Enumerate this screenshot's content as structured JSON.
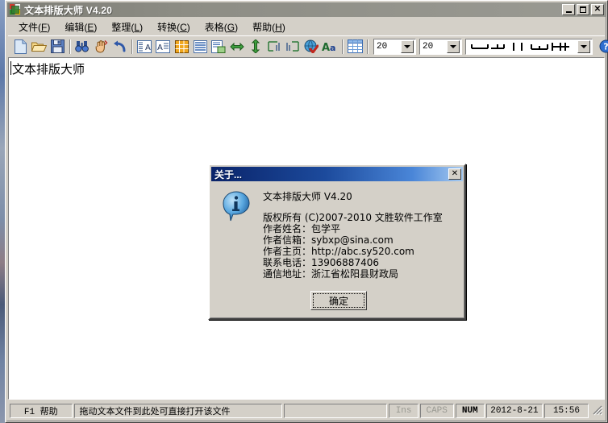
{
  "window": {
    "title": "文本排版大师  V4.20",
    "icon": "app-blocks-icon",
    "buttons": {
      "minimize": "_",
      "maximize": "□",
      "close": "✕"
    }
  },
  "menu": {
    "items": [
      {
        "label": "文件",
        "accel": "F"
      },
      {
        "label": "编辑",
        "accel": "E"
      },
      {
        "label": "整理",
        "accel": "L"
      },
      {
        "label": "转换",
        "accel": "C"
      },
      {
        "label": "表格",
        "accel": "G"
      },
      {
        "label": "帮助",
        "accel": "H"
      }
    ]
  },
  "toolbar": {
    "buttons": [
      {
        "name": "new-file-icon",
        "tip": "新建"
      },
      {
        "name": "open-folder-icon",
        "tip": "打开"
      },
      {
        "name": "save-disk-icon",
        "tip": "保存"
      },
      {
        "name": "find-binoculars-icon",
        "tip": "查找"
      },
      {
        "name": "replace-hand-icon",
        "tip": "替换"
      },
      {
        "name": "undo-arrow-icon",
        "tip": "撤销"
      },
      {
        "name": "paragraph-indent-icon",
        "tip": "段落整理"
      },
      {
        "name": "text-align-icon",
        "tip": "文本对齐"
      },
      {
        "name": "grid-table-icon",
        "tip": "表格"
      },
      {
        "name": "lines-icon",
        "tip": "行处理"
      },
      {
        "name": "copy-page-icon",
        "tip": "复制页"
      },
      {
        "name": "horizontal-arrows-icon",
        "tip": "横向"
      },
      {
        "name": "vertical-arrows-icon",
        "tip": "纵向"
      },
      {
        "name": "align-left-rows-icon",
        "tip": "左对齐"
      },
      {
        "name": "align-right-rows-icon",
        "tip": "右对齐"
      },
      {
        "name": "globe-check-icon",
        "tip": "网页"
      },
      {
        "name": "font-case-icon",
        "tip": "字体转换"
      },
      {
        "name": "insert-table-icon",
        "tip": "插入表格"
      }
    ],
    "combo_rows": {
      "value": "20"
    },
    "combo_cols": {
      "value": "20"
    },
    "combo_border_style": {
      "value": "border-style-preview"
    },
    "help_button": {
      "name": "help-question-icon"
    }
  },
  "document": {
    "text": "文本排版大师"
  },
  "about_dialog": {
    "title": "关于...",
    "close_label": "✕",
    "icon": "info-bubble-icon",
    "app_line": "文本排版大师  V4.20",
    "lines": [
      "版权所有 (C)2007-2010  文胜软件工作室",
      "作者姓名：包学平",
      "作者信箱：sybxp@sina.com",
      "作者主页：http://abc.sy520.com",
      "联系电话：13906887406",
      "通信地址：浙江省松阳县财政局"
    ],
    "ok_label": "确定"
  },
  "status_bar": {
    "help_hint": "F1  帮助",
    "message": "拖动文本文件到此处可直接打开该文件",
    "spacer": "",
    "ins": "Ins",
    "caps": "CAPS",
    "num": "NUM",
    "date": "2012-8-21",
    "time": "15:56"
  },
  "colors": {
    "dialog_title_start": "#0a246a",
    "dialog_title_end": "#a6caf0",
    "window_title_bar": "#8d8d85",
    "face": "#d4d0c8",
    "client": "#ffffff"
  }
}
